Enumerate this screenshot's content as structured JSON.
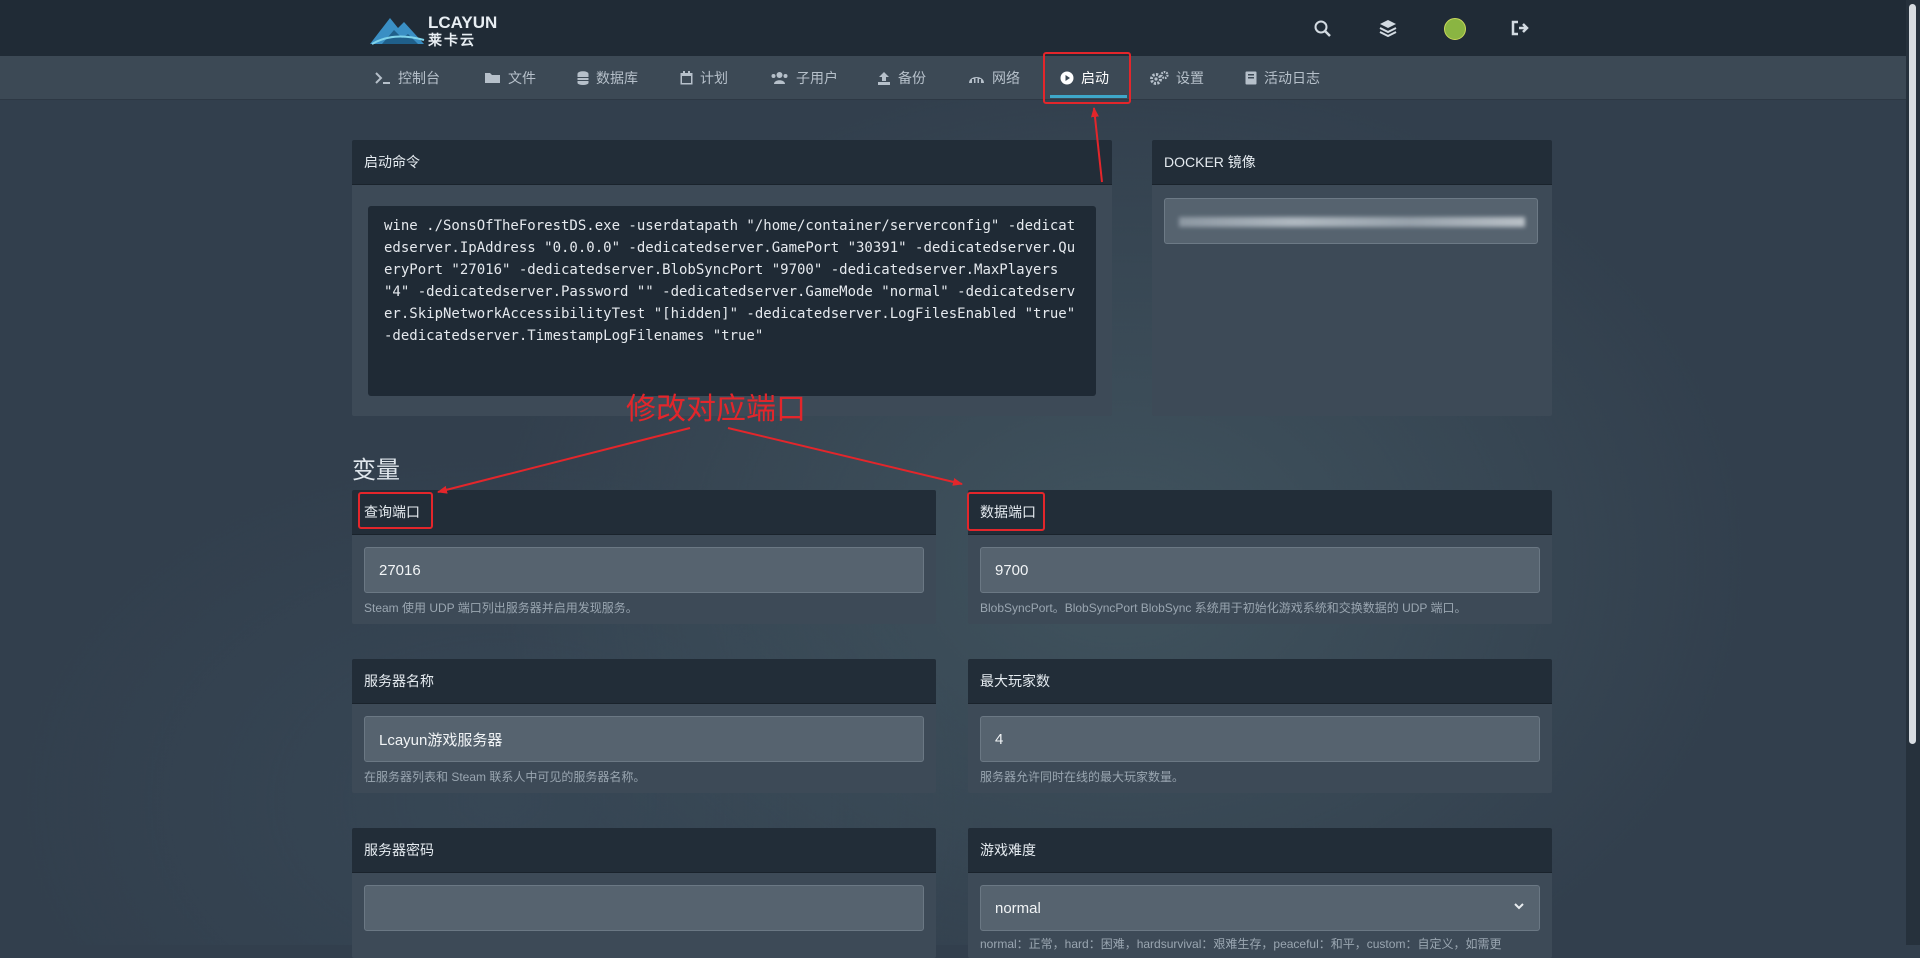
{
  "header": {
    "logo_name": "LCAYUN",
    "logo_cn": "莱卡云",
    "icons": [
      "search-icon",
      "layers-icon",
      "avatar",
      "logout-icon"
    ]
  },
  "nav": {
    "items": [
      {
        "label": "控制台",
        "icon": "terminal-icon"
      },
      {
        "label": "文件",
        "icon": "folder-icon"
      },
      {
        "label": "数据库",
        "icon": "database-icon"
      },
      {
        "label": "计划",
        "icon": "calendar-icon"
      },
      {
        "label": "子用户",
        "icon": "users-icon"
      },
      {
        "label": "备份",
        "icon": "upload-icon"
      },
      {
        "label": "网络",
        "icon": "network-icon"
      },
      {
        "label": "启动",
        "icon": "play-circle-icon"
      },
      {
        "label": "设置",
        "icon": "cogs-icon"
      },
      {
        "label": "活动日志",
        "icon": "book-icon"
      }
    ],
    "active": "启动"
  },
  "startup": {
    "title": "启动命令",
    "command": "wine ./SonsOfTheForestDS.exe -userdatapath \"/home/container/serverconfig\" -dedicatedserver.IpAddress \"0.0.0.0\" -dedicatedserver.GamePort \"30391\" -dedicatedserver.QueryPort \"27016\" -dedicatedserver.BlobSyncPort \"9700\" -dedicatedserver.MaxPlayers \"4\" -dedicatedserver.Password \"\" -dedicatedserver.GameMode \"normal\" -dedicatedserver.SkipNetworkAccessibilityTest \"[hidden]\" -dedicatedserver.LogFilesEnabled \"true\" -dedicatedserver.TimestampLogFilenames \"true\""
  },
  "docker": {
    "title": "DOCKER 镜像"
  },
  "annotation": {
    "text": "修改对应端口",
    "color": "#e3262b"
  },
  "variables": {
    "title": "变量",
    "query_port": {
      "label": "查询端口",
      "value": "27016",
      "hint": "Steam 使用 UDP 端口列出服务器并启用发现服务。"
    },
    "data_port": {
      "label": "数据端口",
      "value": "9700",
      "hint": "BlobSyncPort。BlobSyncPort BlobSync 系统用于初始化游戏系统和交换数据的 UDP 端口。"
    },
    "server_name": {
      "label": "服务器名称",
      "value": "Lcayun游戏服务器",
      "hint": "在服务器列表和 Steam 联系人中可见的服务器名称。"
    },
    "max_players": {
      "label": "最大玩家数",
      "value": "4",
      "hint": "服务器允许同时在线的最大玩家数量。"
    },
    "server_password": {
      "label": "服务器密码",
      "value": ""
    },
    "difficulty": {
      "label": "游戏难度",
      "value": "normal",
      "hint": "normal：正常，hard：困难，hardsurvival：艰难生存，peaceful：和平，custom：自定义，如需更"
    }
  },
  "colors": {
    "accent": "#26c6da",
    "header_bg": "#202b36",
    "panel_bg": "#3d4a57",
    "field_bg": "#56636f",
    "annotation": "#e3262b"
  }
}
